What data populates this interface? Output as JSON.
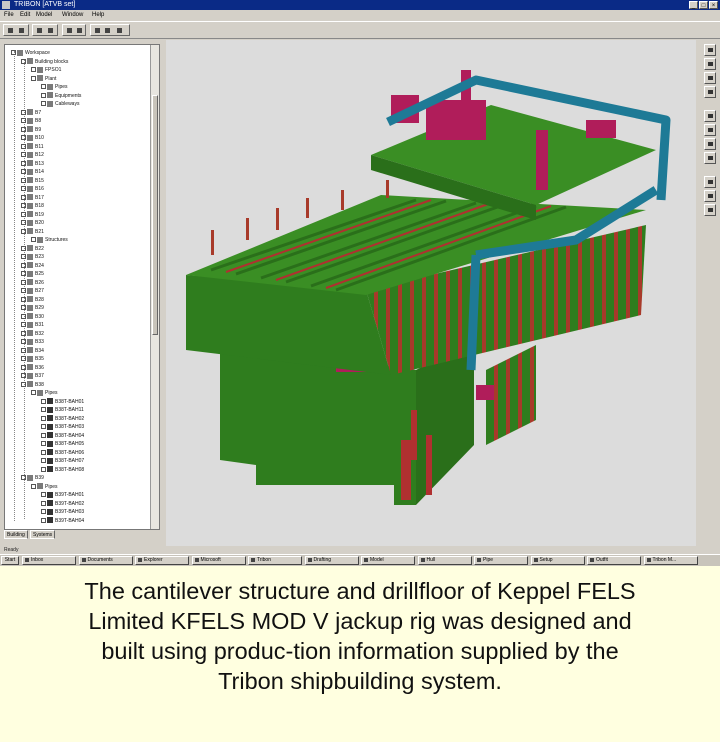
{
  "window": {
    "title": "TRIBON  [ATVB set]",
    "buttons": [
      "_",
      "□",
      "×"
    ]
  },
  "menu": [
    "File",
    "Edit",
    "Model",
    "Window",
    "Help"
  ],
  "tree": {
    "items": [
      {
        "label": "Workspace",
        "indent": 0,
        "icon": "folder"
      },
      {
        "label": "Building blocks",
        "indent": 1,
        "icon": "folder"
      },
      {
        "label": "FPSO1",
        "indent": 2,
        "icon": "folder"
      },
      {
        "label": "Plant",
        "indent": 2,
        "icon": "folder"
      },
      {
        "label": "Pipes",
        "indent": 3,
        "icon": "pipe"
      },
      {
        "label": "Equipments",
        "indent": 3,
        "icon": "folder"
      },
      {
        "label": "Cableways",
        "indent": 3,
        "icon": "folder"
      },
      {
        "label": "B7",
        "indent": 1,
        "icon": "block"
      },
      {
        "label": "B8",
        "indent": 1,
        "icon": "block"
      },
      {
        "label": "B9",
        "indent": 1,
        "icon": "block"
      },
      {
        "label": "B10",
        "indent": 1,
        "icon": "block"
      },
      {
        "label": "B11",
        "indent": 1,
        "icon": "block"
      },
      {
        "label": "B12",
        "indent": 1,
        "icon": "block"
      },
      {
        "label": "B13",
        "indent": 1,
        "icon": "block"
      },
      {
        "label": "B14",
        "indent": 1,
        "icon": "block"
      },
      {
        "label": "B15",
        "indent": 1,
        "icon": "block"
      },
      {
        "label": "B16",
        "indent": 1,
        "icon": "block"
      },
      {
        "label": "B17",
        "indent": 1,
        "icon": "block"
      },
      {
        "label": "B18",
        "indent": 1,
        "icon": "block"
      },
      {
        "label": "B19",
        "indent": 1,
        "icon": "block"
      },
      {
        "label": "B20",
        "indent": 1,
        "icon": "block"
      },
      {
        "label": "B21",
        "indent": 1,
        "icon": "block"
      },
      {
        "label": "Structures",
        "indent": 2,
        "icon": "folder"
      },
      {
        "label": "B22",
        "indent": 1,
        "icon": "block"
      },
      {
        "label": "B23",
        "indent": 1,
        "icon": "block"
      },
      {
        "label": "B24",
        "indent": 1,
        "icon": "block"
      },
      {
        "label": "B25",
        "indent": 1,
        "icon": "block"
      },
      {
        "label": "B26",
        "indent": 1,
        "icon": "block"
      },
      {
        "label": "B27",
        "indent": 1,
        "icon": "block"
      },
      {
        "label": "B28",
        "indent": 1,
        "icon": "block"
      },
      {
        "label": "B29",
        "indent": 1,
        "icon": "block"
      },
      {
        "label": "B30",
        "indent": 1,
        "icon": "block"
      },
      {
        "label": "B31",
        "indent": 1,
        "icon": "block"
      },
      {
        "label": "B32",
        "indent": 1,
        "icon": "block"
      },
      {
        "label": "B33",
        "indent": 1,
        "icon": "block"
      },
      {
        "label": "B34",
        "indent": 1,
        "icon": "block"
      },
      {
        "label": "B35",
        "indent": 1,
        "icon": "block"
      },
      {
        "label": "B36",
        "indent": 1,
        "icon": "block"
      },
      {
        "label": "B37",
        "indent": 1,
        "icon": "block"
      },
      {
        "label": "B38",
        "indent": 1,
        "icon": "block"
      },
      {
        "label": "Pipes",
        "indent": 2,
        "icon": "pipe"
      },
      {
        "label": "B38T-BAH01",
        "indent": 3,
        "icon": "part"
      },
      {
        "label": "B38T-BAH11",
        "indent": 3,
        "icon": "part"
      },
      {
        "label": "B38T-BAH02",
        "indent": 3,
        "icon": "part"
      },
      {
        "label": "B38T-BAH03",
        "indent": 3,
        "icon": "part"
      },
      {
        "label": "B38T-BAH04",
        "indent": 3,
        "icon": "part"
      },
      {
        "label": "B38T-BAH05",
        "indent": 3,
        "icon": "part"
      },
      {
        "label": "B38T-BAH06",
        "indent": 3,
        "icon": "part"
      },
      {
        "label": "B38T-BAH07",
        "indent": 3,
        "icon": "part"
      },
      {
        "label": "B38T-BAH08",
        "indent": 3,
        "icon": "part"
      },
      {
        "label": "B39",
        "indent": 1,
        "icon": "block"
      },
      {
        "label": "Pipes",
        "indent": 2,
        "icon": "pipe"
      },
      {
        "label": "B39T-BAH01",
        "indent": 3,
        "icon": "part"
      },
      {
        "label": "B39T-BAH02",
        "indent": 3,
        "icon": "part"
      },
      {
        "label": "B39T-BAH03",
        "indent": 3,
        "icon": "part"
      },
      {
        "label": "B39T-BAH04",
        "indent": 3,
        "icon": "part"
      }
    ]
  },
  "tabs": [
    "Building",
    "Systems"
  ],
  "status": "Ready",
  "taskbar": {
    "start": "Start",
    "tasks": [
      "Inbox",
      "Documents",
      "Explorer",
      "Microsoft",
      "Tribon",
      "Drafting",
      "Model",
      "Hull",
      "Pipe",
      "Setup",
      "Outfit",
      "Tribon M..."
    ]
  },
  "colors": {
    "structure": "#2f7d1e",
    "deck": "#3a8e24",
    "beams": "#b03030",
    "piping": "#1e7a96",
    "equipment": "#b01d5a"
  },
  "caption": {
    "lines": [
      "The cantilever structure and drillfloor of Keppel FELS",
      "Limited KFELS MOD V jackup rig was designed and",
      "built using produc-tion information supplied by the",
      "Tribon shipbuilding system."
    ]
  }
}
